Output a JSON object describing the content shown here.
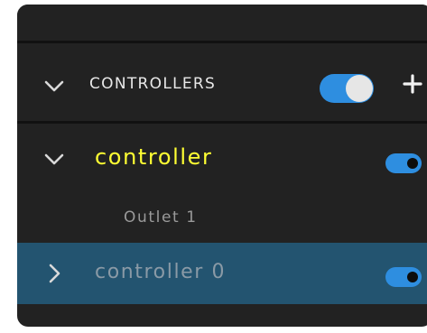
{
  "section": {
    "title": "CONTROLLERS",
    "toggle_on": true,
    "icons": {
      "collapse": "chevron-down-icon",
      "add": "plus-icon"
    }
  },
  "items": [
    {
      "label": "controller",
      "expanded": true,
      "enabled": true,
      "highlight_color": "#ffff33"
    },
    {
      "label": "controller 0",
      "expanded": false,
      "enabled": true,
      "selected": true
    }
  ],
  "subitems": [
    {
      "label": "Outlet 1"
    }
  ],
  "colors": {
    "panel_bg": "#222222",
    "separator": "#111111",
    "selected_row_bg": "#235470",
    "toggle_on": "#2e8ee0"
  }
}
